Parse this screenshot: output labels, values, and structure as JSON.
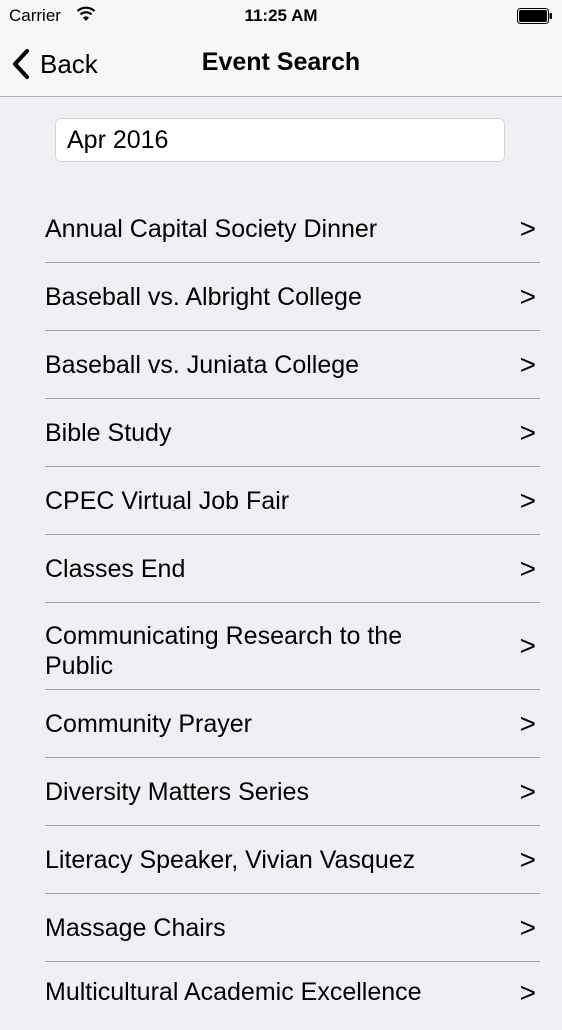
{
  "status_bar": {
    "carrier": "Carrier",
    "time": "11:25 AM"
  },
  "nav": {
    "back_label": "Back",
    "title": "Event Search"
  },
  "month_field": {
    "value": "Apr 2016"
  },
  "chevron_glyph": ">",
  "events": [
    "Annual Capital Society Dinner",
    "Baseball vs. Albright College",
    "Baseball vs. Juniata College",
    "Bible Study",
    "CPEC Virtual Job Fair",
    "Classes End",
    "Communicating Research to the Public",
    "Community Prayer",
    "Diversity Matters Series",
    "Literacy Speaker, Vivian Vasquez",
    "Massage Chairs",
    "Multicultural Academic Excellence"
  ]
}
